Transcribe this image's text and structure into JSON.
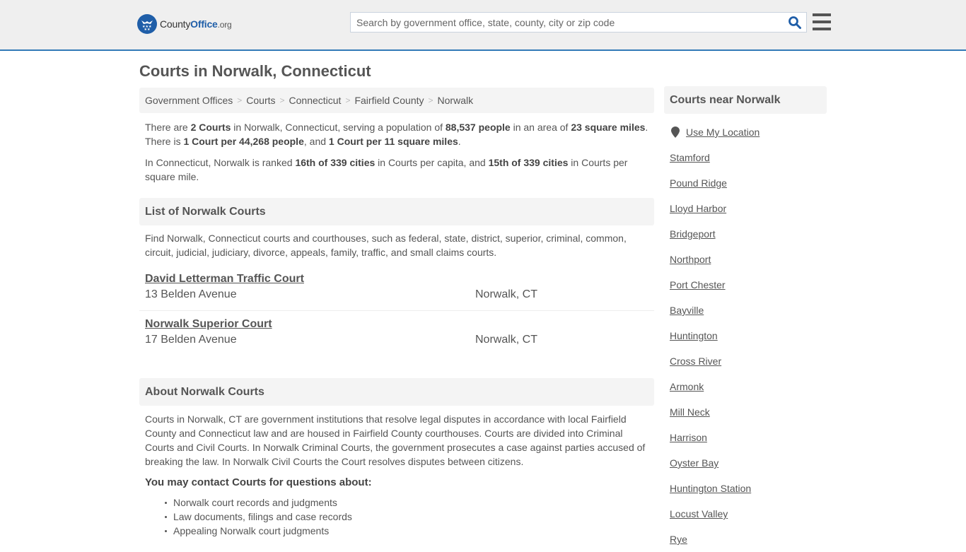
{
  "header": {
    "logo": {
      "part1": "County",
      "part2": "Office",
      "part3": ".org"
    },
    "search": {
      "placeholder": "Search by government office, state, county, city or zip code",
      "value": ""
    }
  },
  "page": {
    "title": "Courts in Norwalk, Connecticut"
  },
  "breadcrumb": [
    {
      "label": "Government Offices"
    },
    {
      "label": "Courts"
    },
    {
      "label": "Connecticut"
    },
    {
      "label": "Fairfield County"
    },
    {
      "label": "Norwalk"
    }
  ],
  "stats": {
    "t1": "There are ",
    "count": "2 Courts",
    "t2": " in Norwalk, Connecticut, serving a population of ",
    "population": "88,537 people",
    "t3": " in an area of ",
    "area": "23 square miles",
    "t4": ". There is ",
    "per_people": "1 Court per 44,268 people",
    "t5": ", and ",
    "per_area": "1 Court per 11 square miles",
    "t6": ".",
    "r1": "In Connecticut, Norwalk is ranked ",
    "rank_capita": "16th of 339 cities",
    "r2": " in Courts per capita, and ",
    "rank_area": "15th of 339 cities",
    "r3": " in Courts per square mile."
  },
  "list": {
    "heading": "List of Norwalk Courts",
    "description": "Find Norwalk, Connecticut courts and courthouses, such as federal, state, district, superior, criminal, common, circuit, judicial, judiciary, divorce, appeals, family, traffic, and small claims courts.",
    "courts": [
      {
        "name": "David Letterman Traffic Court",
        "address": "13 Belden Avenue",
        "city": "Norwalk, CT"
      },
      {
        "name": "Norwalk Superior Court",
        "address": "17 Belden Avenue",
        "city": "Norwalk, CT"
      }
    ]
  },
  "about": {
    "heading": "About Norwalk Courts",
    "text": "Courts in Norwalk, CT are government institutions that resolve legal disputes in accordance with local Fairfield County and Connecticut law and are housed in Fairfield County courthouses. Courts are divided into Criminal Courts and Civil Courts. In Norwalk Criminal Courts, the government prosecutes a case against parties accused of breaking the law. In Norwalk Civil Courts the Court resolves disputes between citizens.",
    "contact_heading": "You may contact Courts for questions about:",
    "contact_items": [
      "Norwalk court records and judgments",
      "Law documents, filings and case records",
      "Appealing Norwalk court judgments"
    ]
  },
  "sidebar": {
    "heading": "Courts near Norwalk",
    "use_location": "Use My Location",
    "cities": [
      "Stamford",
      "Pound Ridge",
      "Lloyd Harbor",
      "Bridgeport",
      "Northport",
      "Port Chester",
      "Bayville",
      "Huntington",
      "Cross River",
      "Armonk",
      "Mill Neck",
      "Harrison",
      "Oyster Bay",
      "Huntington Station",
      "Locust Valley",
      "Rye"
    ]
  },
  "colors": {
    "brand": "#1f5ea8",
    "header_border": "#337ab7",
    "header_bg": "#efefef"
  }
}
